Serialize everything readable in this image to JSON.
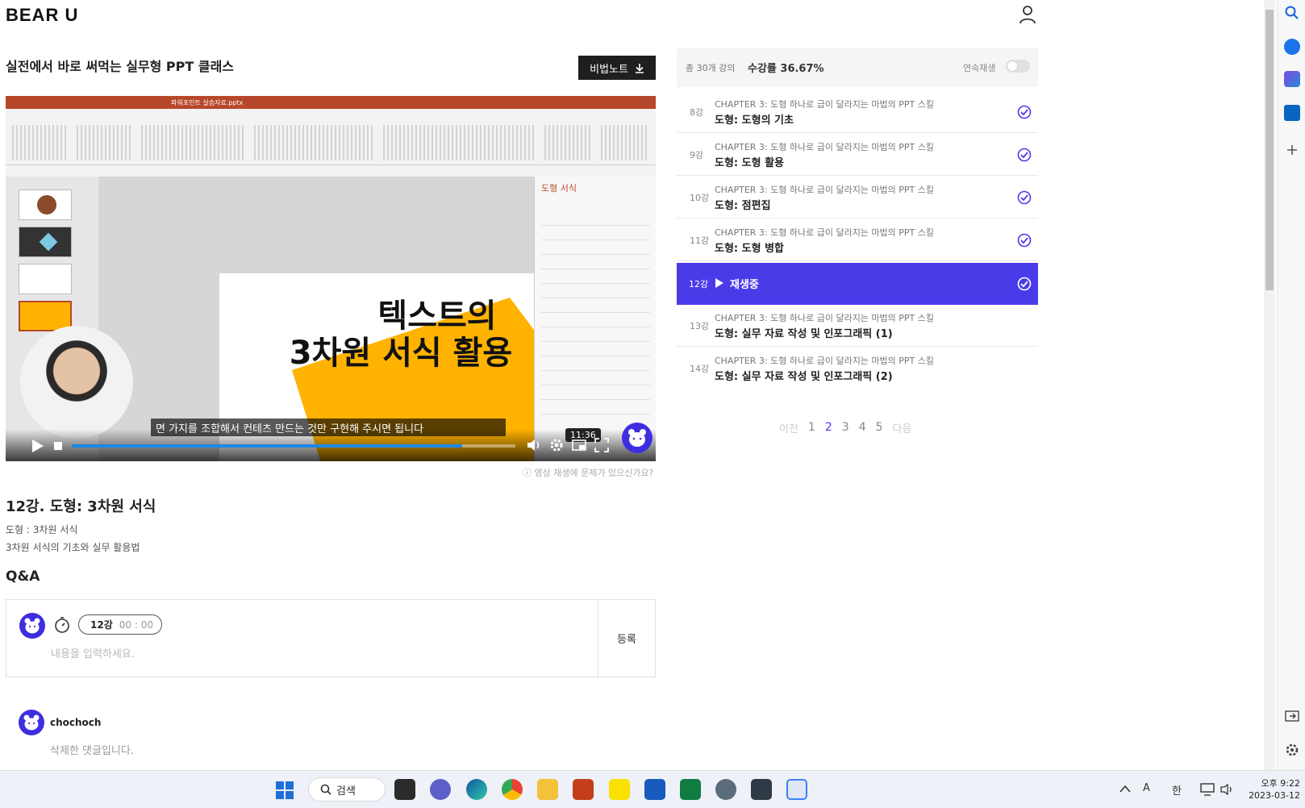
{
  "header": {
    "logo": "BEAR U"
  },
  "course": {
    "title": "실전에서 바로 써먹는 실무형 PPT 클래스",
    "note_button": "비법노트"
  },
  "player": {
    "slide_line1": "텍스트의",
    "slide_line2": "3차원 서식 활용",
    "pane_title": "도형 서식",
    "subtitle": "면 가지를 조합해서 컨테츠 만드는 것만 구현해 주시면 됩니다",
    "time_tooltip": "11:36",
    "progress": 0.88,
    "ppt_file": "파워포인트 실습자료.pptx"
  },
  "report_link": "영상 재생에 문제가 있으신가요?",
  "lecture": {
    "title": "12강. 도형: 3차원 서식",
    "subtitle": "도형 : 3차원 서식",
    "description": "3차원 서식의 기초와 실무 활용법"
  },
  "qa": {
    "heading": "Q&A",
    "chip_lecture": "12강",
    "chip_time": "00 : 00",
    "placeholder": "내용을 입력하세요.",
    "submit": "등록"
  },
  "comment": {
    "user": "chochoch",
    "text": "삭제한 댓글입니다."
  },
  "sidebar": {
    "total": "총 30개 강의",
    "progress_rate": "수강률 36.67%",
    "autoplay_label": "연속재생",
    "autoplay_on": false,
    "lessons": [
      {
        "num": "8강",
        "chapter": "CHAPTER 3: 도형 하나로 급이 달라지는 마법의 PPT 스킬",
        "name": "도형: 도형의 기초"
      },
      {
        "num": "9강",
        "chapter": "CHAPTER 3: 도형 하나로 급이 달라지는 마법의 PPT 스킬",
        "name": "도형: 도형 활용"
      },
      {
        "num": "10강",
        "chapter": "CHAPTER 3: 도형 하나로 급이 달라지는 마법의 PPT 스킬",
        "name": "도형: 점편집"
      },
      {
        "num": "11강",
        "chapter": "CHAPTER 3: 도형 하나로 급이 달라지는 마법의 PPT 스킬",
        "name": "도형: 도형 병합"
      },
      {
        "num": "12강",
        "playing": "재생중"
      },
      {
        "num": "13강",
        "chapter": "CHAPTER 3: 도형 하나로 급이 달라지는 마법의 PPT 스킬",
        "name": "도형: 실무 자료 작성 및 인포그래픽 (1)"
      },
      {
        "num": "14강",
        "chapter": "CHAPTER 3: 도형 하나로 급이 달라지는 마법의 PPT 스킬",
        "name": "도형: 실무 자료 작성 및 인포그래픽 (2)"
      }
    ],
    "pagination": {
      "prev": "이전",
      "pages": [
        "1",
        "2",
        "3",
        "4",
        "5"
      ],
      "current": "2",
      "next": "다음"
    }
  },
  "taskbar": {
    "search_label": "검색",
    "tray_ime1": "A",
    "tray_ime2": "한",
    "clock_time": "오후 9:22",
    "clock_date": "2023-03-12"
  },
  "colors": {
    "accent": "#4a3be8",
    "slide_yellow": "#ffb300",
    "ppt_red": "#b7472a"
  }
}
